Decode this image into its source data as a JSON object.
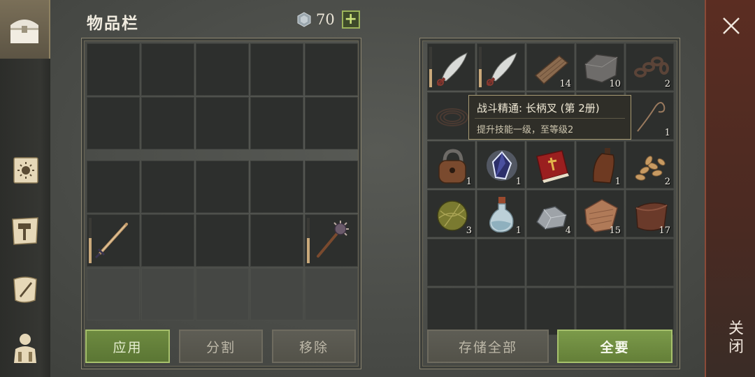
{
  "inventory": {
    "title": "物品栏",
    "currency": {
      "amount": "70",
      "plus_label": "+"
    }
  },
  "left_slots": {
    "r1": [
      "",
      "",
      "",
      "",
      ""
    ],
    "r2": [
      "",
      "",
      "",
      "",
      ""
    ],
    "r3": [
      "",
      "",
      "",
      "",
      ""
    ],
    "r4": [
      "sword",
      "",
      "",
      "",
      "mace"
    ],
    "r5": [
      "",
      "",
      "",
      "",
      ""
    ]
  },
  "right_items": [
    {
      "icon": "machete-icon",
      "qty": "",
      "dura": 0.45
    },
    {
      "icon": "machete-icon",
      "qty": "",
      "dura": 0.45
    },
    {
      "icon": "wood-plank-icon",
      "qty": "14"
    },
    {
      "icon": "stone-block-icon",
      "qty": "10"
    },
    {
      "icon": "chain-icon",
      "qty": "2"
    },
    {
      "icon": "rope-coil-icon",
      "qty": ""
    },
    {
      "icon": "hidden",
      "qty": ""
    },
    {
      "icon": "hidden",
      "qty": ""
    },
    {
      "icon": "hidden",
      "qty": ""
    },
    {
      "icon": "string-icon",
      "qty": "1"
    },
    {
      "icon": "padlock-icon",
      "qty": "1"
    },
    {
      "icon": "crystal-icon",
      "qty": "1"
    },
    {
      "icon": "red-book-icon",
      "qty": ""
    },
    {
      "icon": "bottle-icon",
      "qty": "1"
    },
    {
      "icon": "seeds-icon",
      "qty": "2"
    },
    {
      "icon": "yarn-ball-icon",
      "qty": "3"
    },
    {
      "icon": "potion-flask-icon",
      "qty": "1"
    },
    {
      "icon": "ore-icon",
      "qty": "4"
    },
    {
      "icon": "leather-icon",
      "qty": "15"
    },
    {
      "icon": "hide-scroll-icon",
      "qty": "17"
    }
  ],
  "tooltip": {
    "title": "战斗精通: 长柄叉 (第 2册)",
    "description": "提升技能一级，至等级2"
  },
  "buttons": {
    "apply": "应用",
    "split": "分割",
    "remove": "移除",
    "store_all": "存储全部",
    "take_all": "全要"
  },
  "close": {
    "label": "关闭"
  },
  "colors": {
    "accent_green": "#6d8a40",
    "close_red": "#5b2d22"
  }
}
